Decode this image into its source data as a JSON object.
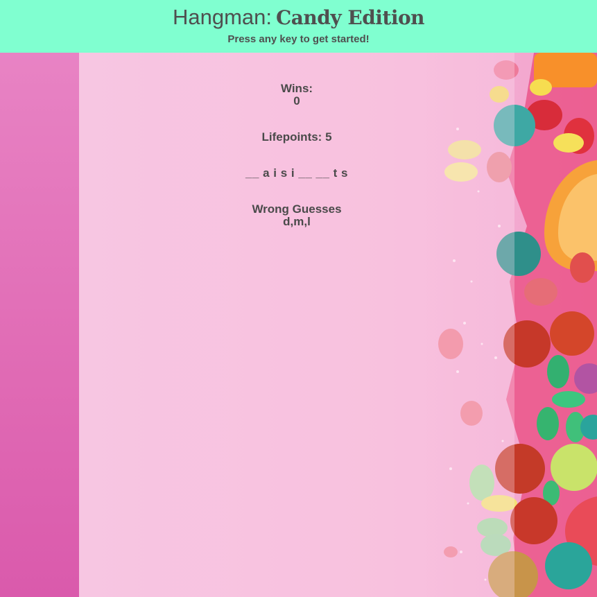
{
  "header": {
    "title_main": "Hangman:",
    "title_accent": "Candy Edition",
    "subtitle": "Press any key to get started!"
  },
  "game": {
    "wins_label": "Wins:",
    "wins_value": "0",
    "lifepoints_text": "Lifepoints: 5",
    "word_display": "__ a i s i __ __ t s",
    "wrong_label": "Wrong Guesses",
    "wrong_value": "d,m,l"
  },
  "colors": {
    "header_bg": "#80ffd0",
    "text": "#4a4a4a",
    "page_pink": "#f5b2d5"
  },
  "background": {
    "icon": "candy-photo-background"
  }
}
